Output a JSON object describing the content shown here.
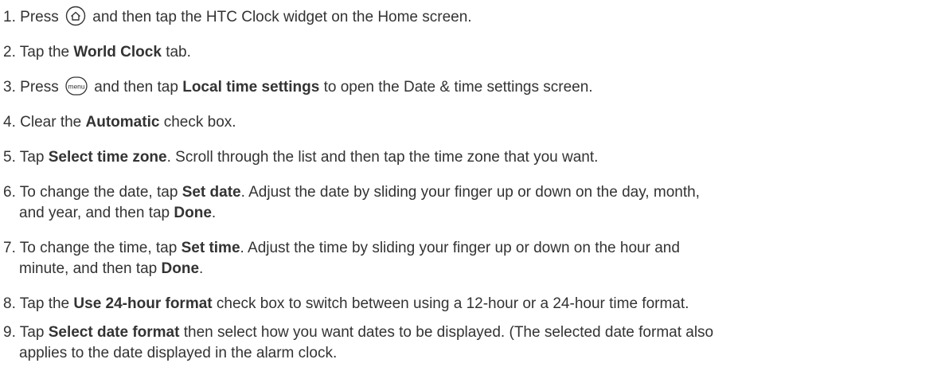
{
  "steps": [
    {
      "number": "1.",
      "a": "Press",
      "icon": "home-key-icon",
      "b": "and then tap the HTC Clock widget on the Home screen."
    },
    {
      "number": "2.",
      "a": "Tap the",
      "bold": "World Clock",
      "b": "tab."
    },
    {
      "number": "3.",
      "a": "Press",
      "icon": "menu-key-icon",
      "icon_text": "menu",
      "b": "and then tap",
      "bold": "Local time settings",
      "c": "to open the Date & time settings screen."
    },
    {
      "number": "4.",
      "a": "Clear the",
      "bold": "Automatic",
      "b": "check box."
    },
    {
      "number": "5.",
      "a": "Tap",
      "bold": "Select time zone",
      "b": ". Scroll through the list and then tap the time zone that you want."
    },
    {
      "number": "6.",
      "a": "To change the date, tap",
      "bold": "Set date",
      "b": ". Adjust the date by sliding your finger up or down on the day, month,",
      "c": "and year, and then tap",
      "bold2": "Done",
      "d": "."
    },
    {
      "number": "7.",
      "a": "To change the time, tap",
      "bold": "Set time",
      "b": ". Adjust the time by sliding your finger up or down on the hour and",
      "c": "minute, and then tap",
      "bold2": "Done",
      "d": "."
    },
    {
      "number": "8.",
      "a": "Tap the",
      "bold": "Use 24-hour format",
      "b": "check box to switch between using a 12-hour or a 24-hour time format."
    },
    {
      "number": "9.",
      "a": "Tap",
      "bold": "Select date format",
      "b": "then select how you want dates to be displayed. (The selected date format also",
      "c": "applies to the date displayed in the alarm clock."
    }
  ]
}
